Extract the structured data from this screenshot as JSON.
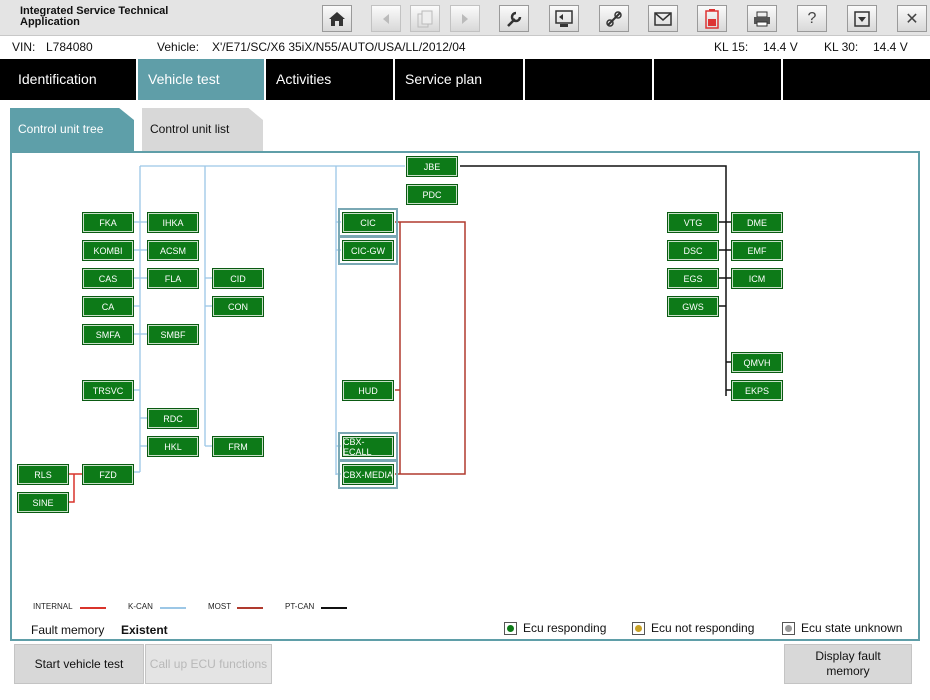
{
  "app": {
    "title": "Integrated Service Technical Application"
  },
  "toolbar": {
    "buttons": [
      {
        "icon": "home-icon",
        "enabled": true
      },
      {
        "icon": "arrow-left-icon",
        "enabled": false
      },
      {
        "icon": "documents-icon",
        "enabled": false
      },
      {
        "icon": "arrow-right-icon",
        "enabled": false
      },
      {
        "icon": "wrench-icon",
        "enabled": true
      },
      {
        "icon": "diagnosis-icon",
        "enabled": true
      },
      {
        "icon": "connection-icon",
        "enabled": true
      },
      {
        "icon": "envelope-icon",
        "enabled": true
      },
      {
        "icon": "battery-icon",
        "enabled": true
      },
      {
        "icon": "printer-icon",
        "enabled": true
      },
      {
        "icon": "help-icon",
        "enabled": true,
        "glyph": "?"
      },
      {
        "icon": "minimize-icon",
        "enabled": true
      },
      {
        "icon": "close-icon",
        "enabled": true,
        "glyph": "✕"
      }
    ]
  },
  "vehicle_info": {
    "vin_label": "VIN:",
    "vin": "L784080",
    "vehicle_label": "Vehicle:",
    "vehicle": "X'/E71/SC/X6 35iX/N55/AUTO/USA/LL/2012/04",
    "kl15_label": "KL 15:",
    "kl15": "14.4 V",
    "kl30_label": "KL 30:",
    "kl30": "14.4 V"
  },
  "nav": {
    "tabs": [
      {
        "label": "Identification",
        "active": false
      },
      {
        "label": "Vehicle test",
        "active": true
      },
      {
        "label": "Activities",
        "active": false
      },
      {
        "label": "Service plan",
        "active": false
      }
    ]
  },
  "subtabs": {
    "tree": "Control unit tree",
    "list": "Control unit list"
  },
  "ecus": {
    "jbe": "JBE",
    "pdc": "PDC",
    "fka": "FKA",
    "ihka": "IHKA",
    "kombi": "KOMBI",
    "acsm": "ACSM",
    "cas": "CAS",
    "fla": "FLA",
    "cid": "CID",
    "ca": "CA",
    "con": "CON",
    "smfa": "SMFA",
    "smbf": "SMBF",
    "trsvc": "TRSVC",
    "rdc": "RDC",
    "hkl": "HKL",
    "frm": "FRM",
    "rls": "RLS",
    "fzd": "FZD",
    "sine": "SINE",
    "cic": "CIC",
    "cicgw": "CIC-GW",
    "hud": "HUD",
    "cbxecall": "CBX-ECALL",
    "cbxmedia": "CBX-MEDIA",
    "vtg": "VTG",
    "dme": "DME",
    "dsc": "DSC",
    "emf": "EMF",
    "egs": "EGS",
    "icm": "ICM",
    "gws": "GWS",
    "qmvh": "QMVH",
    "ekps": "EKPS"
  },
  "legend": {
    "internal": "INTERNAL",
    "kcan": "K-CAN",
    "most": "MOST",
    "ptcan": "PT-CAN"
  },
  "colors": {
    "internal": "#d9342b",
    "kcan": "#9cc7e6",
    "most": "#b03a2e",
    "ptcan": "#111111",
    "ecu_green": "#0d7a18",
    "accent": "#5f9ea8"
  },
  "fault_memory": {
    "label": "Fault memory",
    "value": "Existent"
  },
  "status_keys": {
    "responding": "Ecu responding",
    "not_responding": "Ecu not responding",
    "unknown": "Ecu state unknown"
  },
  "buttons": {
    "start_test": "Start vehicle test",
    "call_ecu": "Call up ECU functions",
    "display_fault": "Display fault memory"
  }
}
